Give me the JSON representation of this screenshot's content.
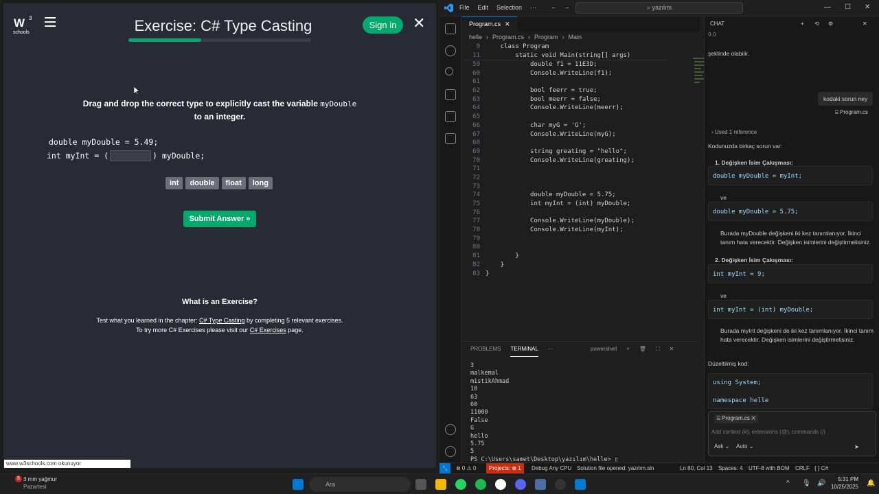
{
  "w3": {
    "exercise_title": "Exercise: C# Type Casting",
    "progress": 0.4,
    "signin_label": "Sign in",
    "instruction_pre": "Drag and drop the correct type to explicitly cast the variable",
    "instruction_var": "myDouble",
    "instruction_post": "to an integer.",
    "code_line1": "double myDouble = 5.49;",
    "code_line2_pre": "int myInt = (",
    "code_line2_post": ") myDouble;",
    "choices": [
      "int",
      "double",
      "float",
      "long"
    ],
    "submit_label": "Submit Answer »",
    "whatis_heading": "What is an Exercise?",
    "test_pre": "Test what you learned in the chapter:",
    "test_link": "C# Type Casting",
    "test_post": "by completing 5 relevant exercises.",
    "try_pre": "To try more C# Exercises please visit our",
    "try_link": "C# Exercises",
    "try_post": "page.",
    "status_url": "www.w3schools.com okunuyor"
  },
  "vscode": {
    "menu": [
      "File",
      "Edit",
      "Selection",
      "···"
    ],
    "search_placeholder": "yazılım",
    "tab_label": "Program.cs",
    "breadcrumb": [
      "helle",
      "Program.cs",
      "Program",
      "Main"
    ],
    "sticky": [
      {
        "n": "9",
        "text": "    class Program"
      },
      {
        "n": "11",
        "text": "        static void Main(string[] args)"
      }
    ],
    "lines": [
      {
        "n": "59",
        "text": "            double f1 = 11E3D;"
      },
      {
        "n": "60",
        "text": "            Console.WriteLine(f1);"
      },
      {
        "n": "61",
        "text": ""
      },
      {
        "n": "62",
        "text": "            bool feerr = true;"
      },
      {
        "n": "63",
        "text": "            bool meerr = false;"
      },
      {
        "n": "64",
        "text": "            Console.WriteLine(meerr);"
      },
      {
        "n": "65",
        "text": ""
      },
      {
        "n": "66",
        "text": "            char myG = 'G';"
      },
      {
        "n": "67",
        "text": "            Console.WriteLine(myG);"
      },
      {
        "n": "68",
        "text": ""
      },
      {
        "n": "69",
        "text": "            string greating = \"hello\";"
      },
      {
        "n": "70",
        "text": "            Console.WriteLine(greating);"
      },
      {
        "n": "71",
        "text": ""
      },
      {
        "n": "72",
        "text": ""
      },
      {
        "n": "73",
        "text": ""
      },
      {
        "n": "74",
        "text": "            double myDouble = 5.75;"
      },
      {
        "n": "75",
        "text": "            int myInt = (int) myDouble;"
      },
      {
        "n": "76",
        "text": ""
      },
      {
        "n": "77",
        "text": "            Console.WriteLine(myDouble);"
      },
      {
        "n": "78",
        "text": "            Console.WriteLine(myInt);"
      },
      {
        "n": "79",
        "text": ""
      },
      {
        "n": "80",
        "text": ""
      },
      {
        "n": "81",
        "text": "        }"
      },
      {
        "n": "82",
        "text": "    }"
      },
      {
        "n": "83",
        "text": "}"
      }
    ],
    "panel_tabs": [
      "PROBLEMS",
      "TERMINAL",
      "···"
    ],
    "terminal_shell": "powershell",
    "terminal_lines": [
      "3",
      "malkemal",
      "mistikAhmad",
      "10",
      "63",
      "60",
      "11000",
      "False",
      "G",
      "hello",
      "5.75",
      "5",
      "PS C:\\Users\\samet\\Desktop\\yazılım\\helle> ▯"
    ],
    "statusbar": {
      "errors": "⊗ 0 ⚠ 0",
      "projects": "Projects: ⊗ 1",
      "debug": "Debug Any CPU",
      "solution": "Solution file opened: yazılım.sln",
      "position": "Ln 80, Col 13",
      "spaces": "Spaces: 4",
      "encoding": "UTF-8 with BOM",
      "eol": "CRLF",
      "lang": "{ } C#"
    }
  },
  "chat": {
    "header": "CHAT",
    "top_snippet": "9.0",
    "line_olabilir": "şeklinde olabilir.",
    "user_msg": "kodaki sorun ney",
    "user_ref": "Program.cs",
    "used_ref": "Used 1 reference",
    "intro": "Kodunuzda birkaç sorun var:",
    "item1_title": "1. Değişken İsim Çakışması:",
    "code_a": "double myDouble = myInt;",
    "ve1": "ve",
    "code_b": "double myDouble = 5.75;",
    "para1": "Burada  myDouble  değişkeni iki kez tanımlanıyor. İkinci tanım hata verecektir. Değişken isimlerini değiştirmelisiniz.",
    "item2_title": "2. Değişken İsim Çakışması:",
    "code_c": "int myInt = 9;",
    "ve2": "ve",
    "code_d": "int myInt = (int) myDouble;",
    "para2": "Burada  myInt  değişkeni de iki kez tanımlanıyor. İkinci tanım hata verecektir. Değişken isimlerini değiştirmelisiniz.",
    "fixed_label": "Düzeltilmiş kod:",
    "code_e1": "using System;",
    "code_e2": "namespace helle",
    "attach_label": "Program.cs",
    "input_placeholder": "Add context (#), extensions (@), commands (/)",
    "mode": "Ask",
    "model": "Auto"
  },
  "taskbar": {
    "weather_temp": "3 mm yağmur",
    "weather_day": "Pazartesi",
    "weather_badge": "5",
    "search_placeholder": "Ara",
    "time": "5:31 PM",
    "date": "10/25/2025"
  }
}
